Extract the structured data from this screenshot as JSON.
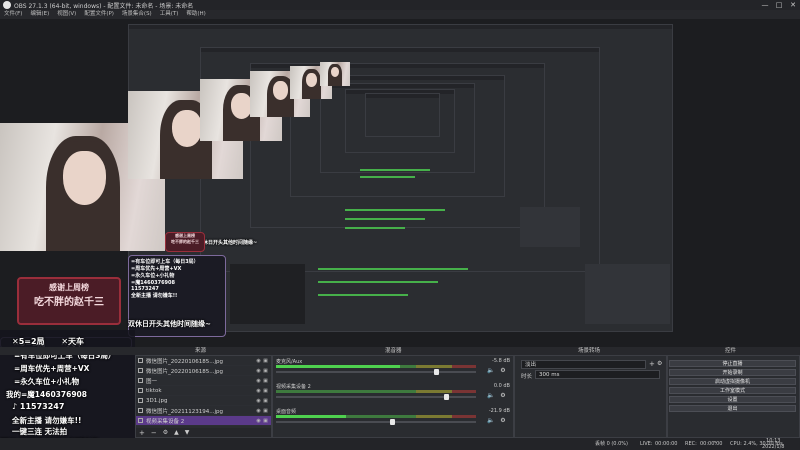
{
  "window": {
    "title": "OBS 27.1.3 (64-bit, windows) - 配置文件: 未命名 - 场景: 未命名",
    "controls": [
      "—",
      "□",
      "✕"
    ]
  },
  "menu": [
    "文件(F)",
    "编辑(E)",
    "视图(V)",
    "配置文件(P)",
    "场景集合(S)",
    "工具(T)",
    "帮助(H)"
  ],
  "overlay": {
    "rule1": "✕5=2局",
    "car_label": "✕天车",
    "line1": "=有车位即可上车（每日3局）",
    "line2": "=周车优先+周营+VX",
    "line3": "=永久车位+小礼物",
    "wechat_prefix": "我的",
    "wechat_id": "=魔1460376908",
    "tiktok_id": "11573247",
    "notice1": "全新主播  请勿嫌车!!",
    "notice2": "一键三连  无法拍",
    "schedule": "双休日开头其他时间随缘~",
    "thanks": "感谢上周榜",
    "thanks_name": "吃不胖的赵千三"
  },
  "docks": {
    "scenes": "",
    "sources": "来源",
    "mixer": "混音器",
    "transitions": "场景转场",
    "controls": "控件"
  },
  "sources": [
    {
      "name": "微信图片_20220106185...jpg",
      "selected": false
    },
    {
      "name": "微信图片_20220106185...jpg",
      "selected": false
    },
    {
      "name": "图一",
      "selected": false
    },
    {
      "name": "tiktok",
      "selected": false
    },
    {
      "name": "3D1.jpg",
      "selected": false
    },
    {
      "name": "微信图片_20211123194...jpg",
      "selected": false
    },
    {
      "name": "视频采集设备 2",
      "selected": true
    }
  ],
  "mixer": [
    {
      "name": "麦克风/Aux",
      "db": "-5.8 dB",
      "level": 0.62,
      "fader": 0.8
    },
    {
      "name": "视频采集设备 2",
      "db": "0.0 dB",
      "level": 0.0,
      "fader": 0.85
    },
    {
      "name": "桌面音频",
      "db": "-21.9 dB",
      "level": 0.35,
      "fader": 0.58
    }
  ],
  "transitions": {
    "type": "淡出",
    "duration_label": "时长",
    "duration": "300 ms"
  },
  "controls": [
    "停止直播",
    "开始录制",
    "启动虚拟摄像机",
    "工作室模式",
    "设置",
    "退出"
  ],
  "status": {
    "dropped_frames": "丢帧 0 (0.0%)",
    "live_label": "LIVE:",
    "live_time": "00:00:00",
    "rec_label": "REC:",
    "rec_time": "00:00:00",
    "cpu": "CPU: 2.4%, 30.00 fps",
    "kbps": "kb/s",
    "clock_time": "10:13",
    "clock_date": "2022/1/8"
  },
  "colors": {
    "accent": "#5b3a8a",
    "meter_green": "#4fd14f",
    "bg": "#2b2d31"
  }
}
